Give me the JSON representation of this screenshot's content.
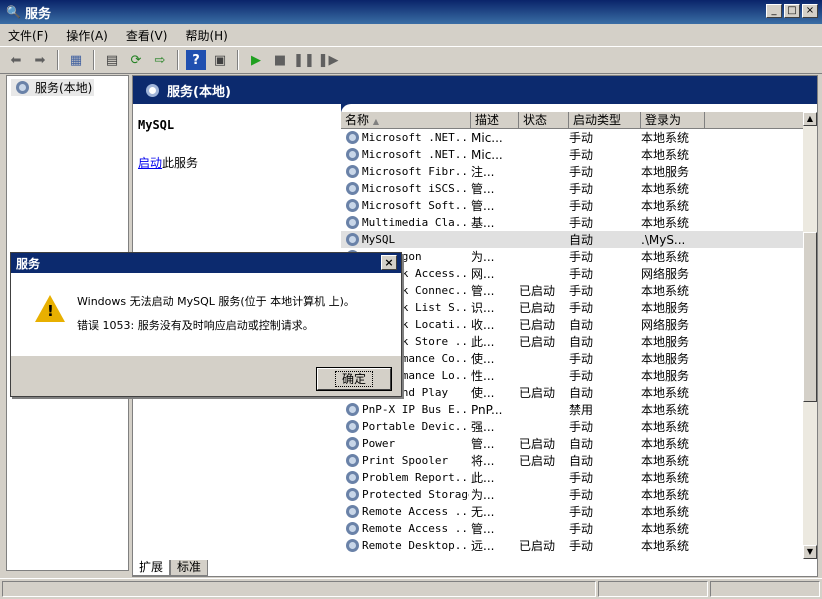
{
  "window": {
    "title": "服务",
    "min": "_",
    "max": "□",
    "close": "×"
  },
  "menu": [
    "文件(F)",
    "操作(A)",
    "查看(V)",
    "帮助(H)"
  ],
  "toolbar_icons": [
    "back-icon",
    "forward-icon",
    "up-icon",
    "properties-icon",
    "refresh-icon",
    "export-icon",
    "help-icon",
    "view-icon",
    "play-icon",
    "stop-icon",
    "pause-icon",
    "resume-icon"
  ],
  "tree": {
    "root": "服务(本地)"
  },
  "pane": {
    "header": "服务(本地)",
    "selected_service": "MySQL",
    "action_link": "启动",
    "action_rest": "此服务"
  },
  "columns": [
    "名称",
    "描述",
    "状态",
    "启动类型",
    "登录为"
  ],
  "rows": [
    [
      "Microsoft .NET...",
      "Mic...",
      "",
      "手动",
      "本地系统"
    ],
    [
      "Microsoft .NET...",
      "Mic...",
      "",
      "手动",
      "本地系统"
    ],
    [
      "Microsoft Fibr...",
      "注...",
      "",
      "手动",
      "本地服务"
    ],
    [
      "Microsoft iSCS...",
      "管...",
      "",
      "手动",
      "本地系统"
    ],
    [
      "Microsoft Soft...",
      "管...",
      "",
      "手动",
      "本地系统"
    ],
    [
      "Multimedia Cla...",
      "基...",
      "",
      "手动",
      "本地系统"
    ],
    [
      "MySQL",
      "",
      "",
      "自动",
      ".\\MyS..."
    ],
    [
      "Net Logon",
      "为...",
      "",
      "手动",
      "本地系统"
    ],
    [
      "Network Access...",
      "网...",
      "",
      "手动",
      "网络服务"
    ],
    [
      "Network Connec...",
      "管...",
      "已启动",
      "手动",
      "本地系统"
    ],
    [
      "Network List S...",
      "识...",
      "已启动",
      "手动",
      "本地服务"
    ],
    [
      "Network Locati...",
      "收...",
      "已启动",
      "自动",
      "网络服务"
    ],
    [
      "Network Store ...",
      "此...",
      "已启动",
      "自动",
      "本地服务"
    ],
    [
      "Performance Co...",
      "使...",
      "",
      "手动",
      "本地服务"
    ],
    [
      "Performance Lo...",
      "性...",
      "",
      "手动",
      "本地服务"
    ],
    [
      "Plug and Play",
      "使...",
      "已启动",
      "自动",
      "本地系统"
    ],
    [
      "PnP-X IP Bus E...",
      "PnP...",
      "",
      "禁用",
      "本地系统"
    ],
    [
      "Portable Devic...",
      "强...",
      "",
      "手动",
      "本地系统"
    ],
    [
      "Power",
      "管...",
      "已启动",
      "自动",
      "本地系统"
    ],
    [
      "Print Spooler",
      "将...",
      "已启动",
      "自动",
      "本地系统"
    ],
    [
      "Problem Report...",
      "此...",
      "",
      "手动",
      "本地系统"
    ],
    [
      "Protected Storage",
      "为...",
      "",
      "手动",
      "本地系统"
    ],
    [
      "Remote Access ...",
      "无...",
      "",
      "手动",
      "本地系统"
    ],
    [
      "Remote Access ...",
      "管...",
      "",
      "手动",
      "本地系统"
    ],
    [
      "Remote Desktop...",
      "远...",
      "已启动",
      "手动",
      "本地系统"
    ]
  ],
  "tabs": [
    "扩展",
    "标准"
  ],
  "dialog": {
    "title": "服务",
    "line1": "Windows 无法启动 MySQL 服务(位于 本地计算机 上)。",
    "line2": "错误 1053: 服务没有及时响应启动或控制请求。",
    "ok": "确定",
    "close": "×"
  }
}
